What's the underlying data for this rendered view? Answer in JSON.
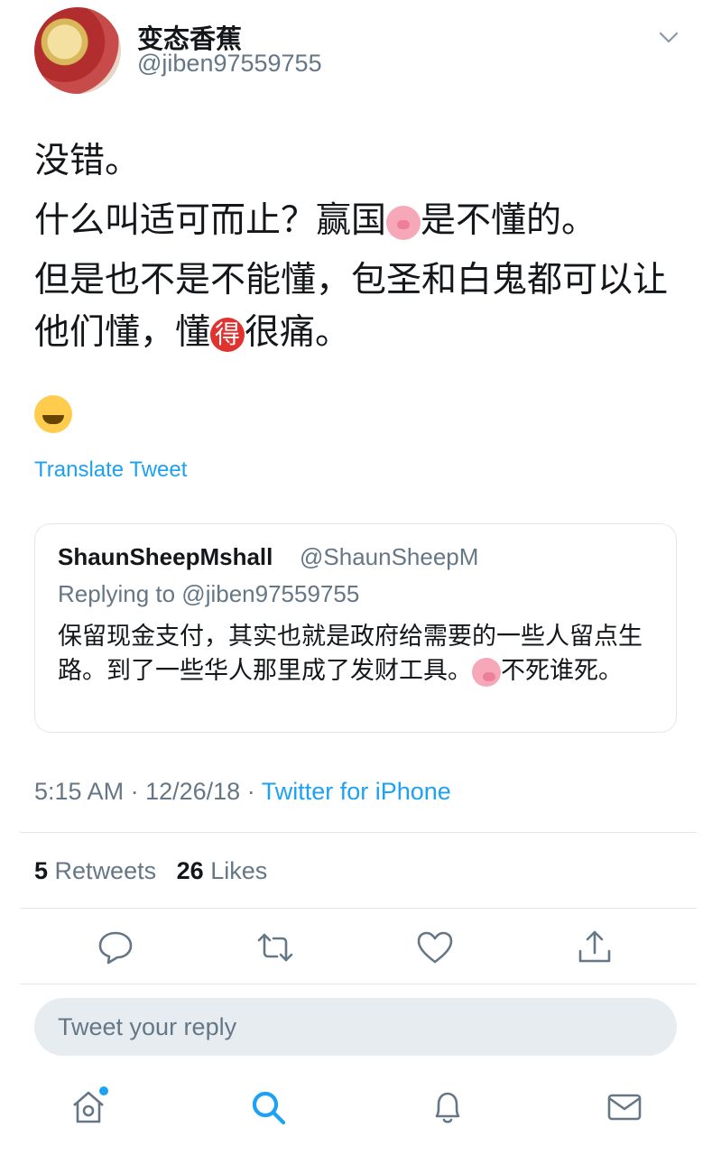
{
  "author": {
    "display_name": "变态香蕉",
    "handle": "@jiben97559755"
  },
  "tweet": {
    "paragraphs": [
      "没错。",
      "什么叫适可而止？赢国🐷是不懂的。",
      "但是也不是不能懂，包圣和白鬼都可以让他们懂，懂🉐很痛。"
    ],
    "p1": "没错。",
    "p2_before": "什么叫适可而止？赢国",
    "p2_after": "是不懂的。",
    "p3_before": "但是也不是不能懂，包圣和白鬼都可以让他们懂，懂",
    "p3_emoji": "得",
    "p3_after": "很痛。",
    "laugh_emoji": "😂",
    "translate_label": "Translate Tweet"
  },
  "quoted_tweet": {
    "name": "ShaunSheepMshall",
    "handle": "@ShaunSheepM",
    "replying_to": "Replying to @jiben97559755",
    "text_before": "保留现金支付，其实也就是政府给需要的一些人留点生路。到了一些华人那里成了发财工具。",
    "text_after": "不死谁死。"
  },
  "meta": {
    "time": "5:15 AM",
    "date": "12/26/18",
    "separator": "·",
    "source": "Twitter for iPhone"
  },
  "stats": {
    "retweets_count": "5",
    "retweets_label": "Retweets",
    "likes_count": "26",
    "likes_label": "Likes"
  },
  "actions": [
    "reply-icon",
    "retweet-icon",
    "like-icon",
    "share-icon"
  ],
  "reply_box": {
    "placeholder": "Tweet your reply"
  },
  "bottom_nav": [
    "home-icon",
    "search-icon",
    "notifications-icon",
    "messages-icon"
  ],
  "colors": {
    "accent": "#1da1f2",
    "secondary_text": "#657786",
    "primary_text": "#14171a",
    "divider": "#e1e8ed",
    "reply_box_bg": "#e6ecf0"
  }
}
